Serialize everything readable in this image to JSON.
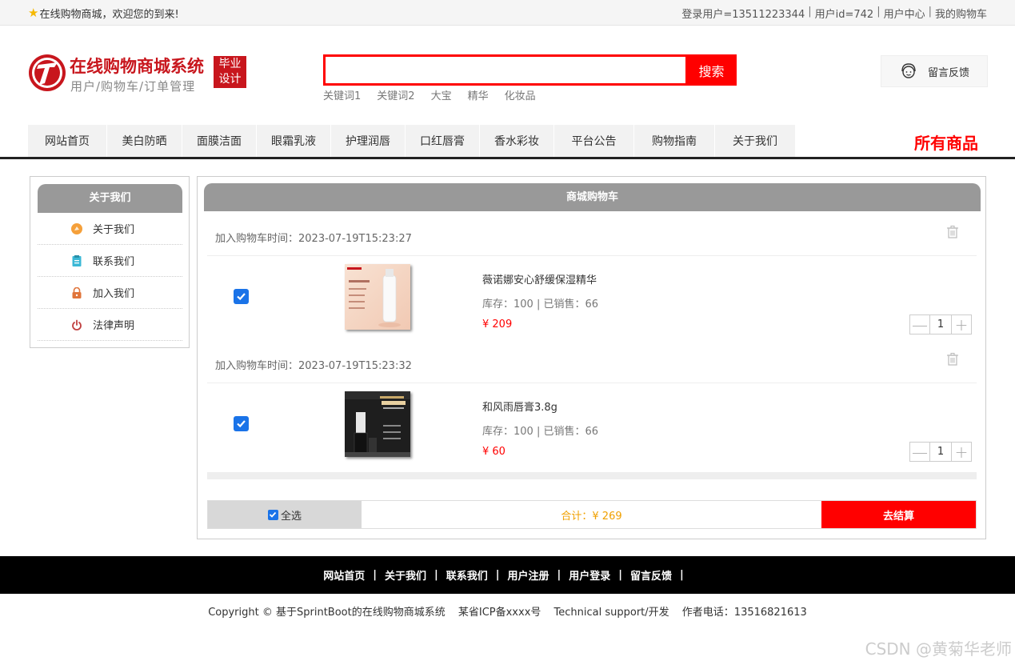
{
  "topbar": {
    "welcome": "在线购物商城，欢迎您的到来!",
    "login_user": "登录用户=13511223344",
    "user_id": "用户id=742",
    "user_center": "用户中心",
    "my_cart": "我的购物车"
  },
  "header": {
    "site_title": "在线购物商城系统",
    "subtitle": "用户/购物车/订单管理",
    "badge_line1": "毕业",
    "badge_line2": "设计",
    "search_placeholder": "",
    "search_button": "搜索",
    "keywords": [
      "关键词1",
      "关键词2",
      "大宝",
      "精华",
      "化妆品"
    ],
    "feedback": "留言反馈"
  },
  "nav": {
    "items": [
      "网站首页",
      "美白防晒",
      "面膜洁面",
      "眼霜乳液",
      "护理润唇",
      "口红唇膏",
      "香水彩妆",
      "平台公告",
      "购物指南",
      "关于我们"
    ],
    "all_goods": "所有商品"
  },
  "sidebar": {
    "title": "关于我们",
    "items": [
      {
        "label": "关于我们",
        "icon": "about-icon",
        "color": "#f5a03a"
      },
      {
        "label": "联系我们",
        "icon": "clipboard-icon",
        "color": "#3bb8d6"
      },
      {
        "label": "加入我们",
        "icon": "lock-icon",
        "color": "#e0743a"
      },
      {
        "label": "法律声明",
        "icon": "power-icon",
        "color": "#c04040"
      }
    ]
  },
  "cart": {
    "title": "商城购物车",
    "items": [
      {
        "added_time": "加入购物车时间：2023-07-19T15:23:27",
        "name": "薇诺娜安心舒缓保湿精华",
        "stock": "库存：100 | 已销售：66",
        "price": "¥ 209",
        "quantity": "1",
        "checked": true
      },
      {
        "added_time": "加入购物车时间：2023-07-19T15:23:32",
        "name": "和风雨唇膏3.8g",
        "stock": "库存：100 | 已销售：66",
        "price": "¥ 60",
        "quantity": "1",
        "checked": true
      }
    ],
    "select_all": "全选",
    "total": "合计：¥ 269",
    "checkout": "去结算"
  },
  "footer": {
    "links": [
      "网站首页",
      "关于我们",
      "联系我们",
      "用户注册",
      "用户登录",
      "留言反馈"
    ],
    "copyright": "Copyright © 基于SprintBoot的在线购物商城系统",
    "icp": "某省ICP备xxxx号",
    "support": "Technical support/开发",
    "phone": "作者电话：13516821613"
  },
  "watermark": "CSDN @黄菊华老师",
  "colors": {
    "accent": "#ff0000",
    "brand": "#c8161d",
    "header_gray": "#999999",
    "total": "#f0a000"
  }
}
